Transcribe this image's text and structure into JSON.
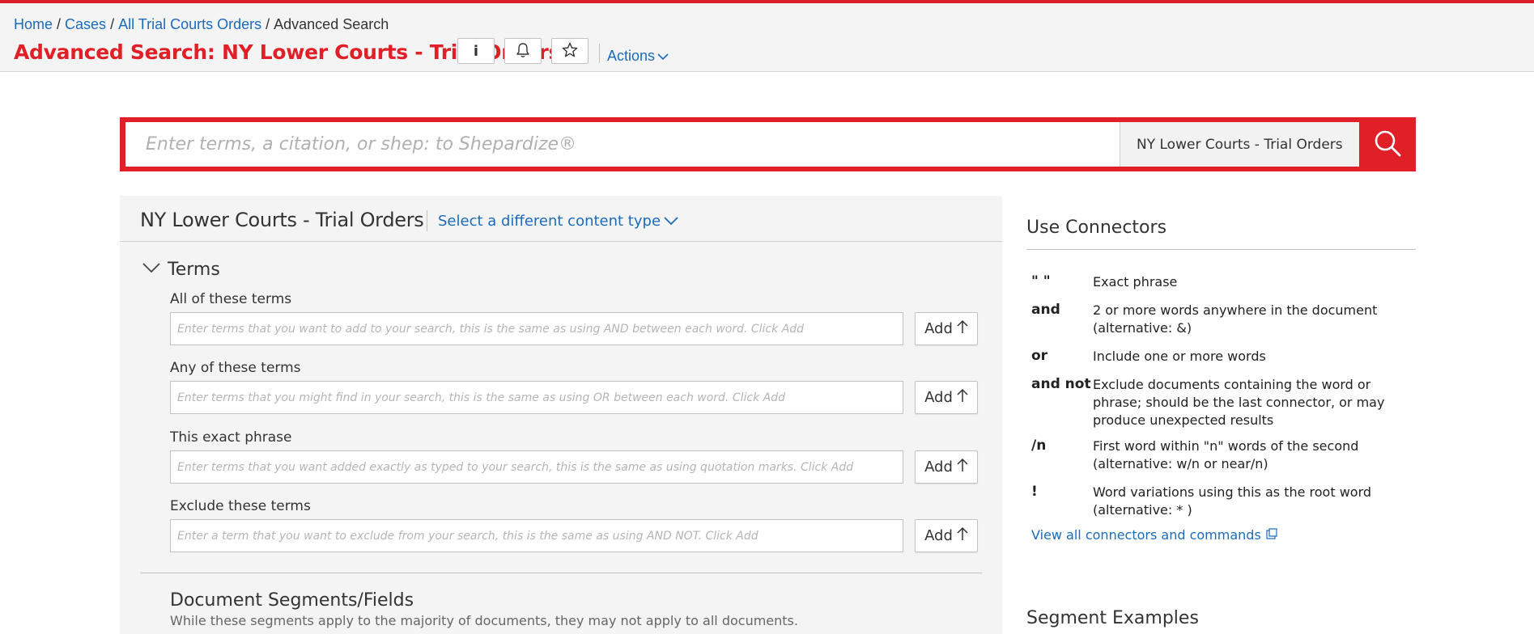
{
  "breadcrumb": {
    "home": "Home",
    "cases": "Cases",
    "all_trial": "All Trial Courts Orders",
    "current": "Advanced Search",
    "separator": "/"
  },
  "header": {
    "title": "Advanced Search: NY Lower Courts - Trial Orders",
    "info_label": "i",
    "actions_label": "Actions"
  },
  "search": {
    "placeholder": "Enter terms, a citation, or shep: to Shepardize®",
    "value": "",
    "scope": "NY Lower Courts - Trial Orders"
  },
  "content_panel": {
    "title": "NY Lower Courts - Trial Orders",
    "select_label": "Select a different content type",
    "terms_section": "Terms",
    "fields": [
      {
        "label": "All of these terms",
        "placeholder": "Enter terms that you want to add to your search, this is the same as using AND between each word. Click Add",
        "value": "",
        "add_label": "Add"
      },
      {
        "label": "Any of these terms",
        "placeholder": "Enter terms that you might find in your search, this is the same as using OR between each word. Click Add",
        "value": "",
        "add_label": "Add"
      },
      {
        "label": "This exact phrase",
        "placeholder": "Enter terms that you want added exactly as typed to your search, this is the same as using quotation marks. Click Add",
        "value": "",
        "add_label": "Add"
      },
      {
        "label": "Exclude these terms",
        "placeholder": "Enter a term that you want to exclude from your search, this is the same as using AND NOT. Click Add",
        "value": "",
        "add_label": "Add"
      }
    ],
    "segments_title": "Document Segments/Fields",
    "segments_subtitle": "While these segments apply to the majority of documents, they may not apply to all documents."
  },
  "connectors": {
    "title": "Use Connectors",
    "items": [
      {
        "symbol": "\" \"",
        "description": "Exact phrase"
      },
      {
        "symbol": "and",
        "description": "2 or more words anywhere in the document (alternative: &)"
      },
      {
        "symbol": "or",
        "description": "Include one or more words"
      },
      {
        "symbol": "and not",
        "description": "Exclude documents containing the word or phrase; should be the last connector, or may produce unexpected results"
      },
      {
        "symbol": "/n",
        "description": "First word within \"n\" words of the second (alternative: w/n or near/n)"
      },
      {
        "symbol": "!",
        "description": "Word variations using this as the root word (alternative: * )"
      }
    ],
    "view_all": "View all connectors and commands"
  },
  "segment_examples_title": "Segment Examples",
  "icons": {
    "search": "search-icon",
    "bell": "bell-icon",
    "star": "star-icon",
    "chevron": "chevron-down-icon",
    "arrow_up": "arrow-up-icon",
    "external": "external-link-icon"
  },
  "colors": {
    "brand_red": "#e01f26",
    "link_blue": "#1a6bbd",
    "header_bg": "#f4f4f4",
    "panel_bg": "#f4f4f4"
  }
}
